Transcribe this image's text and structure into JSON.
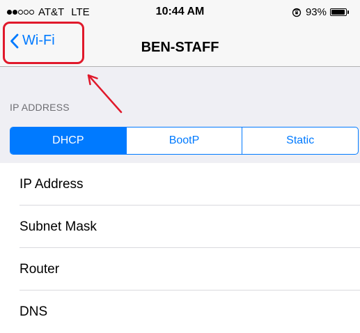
{
  "status_bar": {
    "carrier": "AT&T",
    "network": "LTE",
    "time": "10:44 AM",
    "battery_percent": "93%",
    "battery_level": 0.93,
    "signal_bars": 2,
    "signal_max": 5,
    "icons": [
      "signal-dots-icon",
      "orientation-lock-icon",
      "battery-icon"
    ]
  },
  "nav": {
    "back_label": "Wi-Fi",
    "title": "BEN-STAFF",
    "back_icon": "chevron-left-icon"
  },
  "section": {
    "header": "IP ADDRESS"
  },
  "segments": [
    {
      "label": "DHCP",
      "selected": true
    },
    {
      "label": "BootP",
      "selected": false
    },
    {
      "label": "Static",
      "selected": false
    }
  ],
  "rows": [
    {
      "label": "IP Address"
    },
    {
      "label": "Subnet Mask"
    },
    {
      "label": "Router"
    },
    {
      "label": "DNS"
    }
  ],
  "colors": {
    "accent": "#007aff",
    "highlight": "#e0192b",
    "grouped_background": "#efeff4",
    "bar_background": "#f7f7f7"
  },
  "annotation": {
    "type": "highlight-box-with-arrow",
    "target": "back-button"
  }
}
